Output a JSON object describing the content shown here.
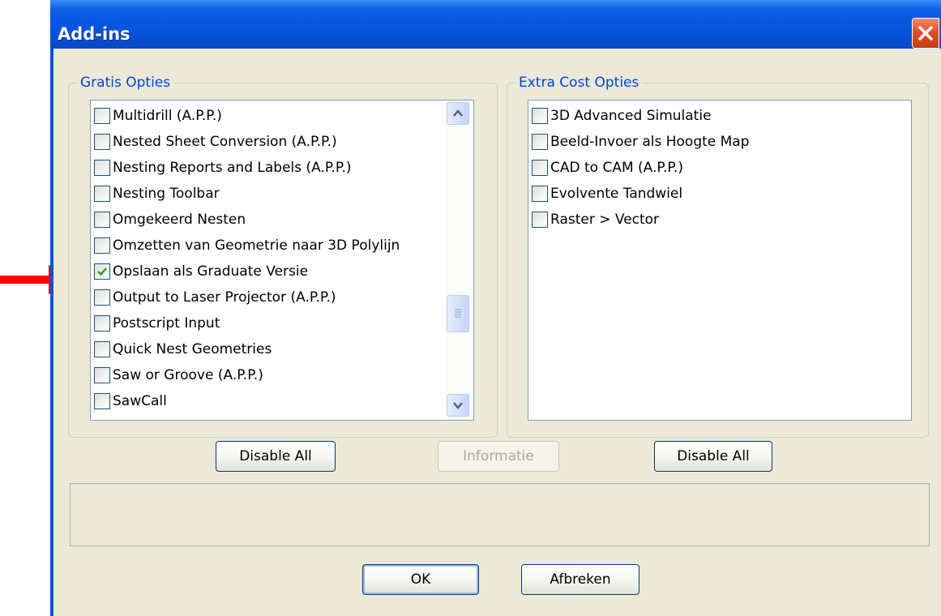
{
  "window": {
    "title": "Add-ins"
  },
  "free_group": {
    "legend": "Gratis Opties",
    "items": [
      {
        "label": "Multidrill (A.P.P.)",
        "checked": false
      },
      {
        "label": "Nested Sheet Conversion (A.P.P.)",
        "checked": false
      },
      {
        "label": "Nesting Reports and Labels (A.P.P.)",
        "checked": false
      },
      {
        "label": "Nesting Toolbar",
        "checked": false
      },
      {
        "label": "Omgekeerd Nesten",
        "checked": false
      },
      {
        "label": "Omzetten van Geometrie naar 3D Polylijn",
        "checked": false
      },
      {
        "label": "Opslaan als Graduate Versie",
        "checked": true
      },
      {
        "label": "Output to Laser Projector (A.P.P.)",
        "checked": false
      },
      {
        "label": "Postscript Input",
        "checked": false
      },
      {
        "label": "Quick Nest Geometries",
        "checked": false
      },
      {
        "label": "Saw or Groove (A.P.P.)",
        "checked": false
      },
      {
        "label": "SawCall",
        "checked": false
      }
    ]
  },
  "extra_group": {
    "legend": "Extra Cost Opties",
    "items": [
      {
        "label": "3D Advanced Simulatie",
        "checked": false
      },
      {
        "label": "Beeld-Invoer als Hoogte Map",
        "checked": false
      },
      {
        "label": "CAD to CAM (A.P.P.)",
        "checked": false
      },
      {
        "label": "Evolvente Tandwiel",
        "checked": false
      },
      {
        "label": "Raster > Vector",
        "checked": false
      }
    ]
  },
  "buttons": {
    "disable_all_left": "Disable All",
    "informatie": "Informatie",
    "disable_all_right": "Disable All",
    "ok": "OK",
    "cancel": "Afbreken"
  },
  "colors": {
    "titlebar": "#0554de",
    "dialog_bg": "#ece9d8",
    "group_legend": "#0046d5",
    "annotation_arrow": "#ff0000",
    "checkmark": "#21a121"
  },
  "icons": {
    "close": "close-icon",
    "scroll_up": "chevron-up-icon",
    "scroll_down": "chevron-down-icon",
    "annotation": "red-arrow-icon"
  }
}
